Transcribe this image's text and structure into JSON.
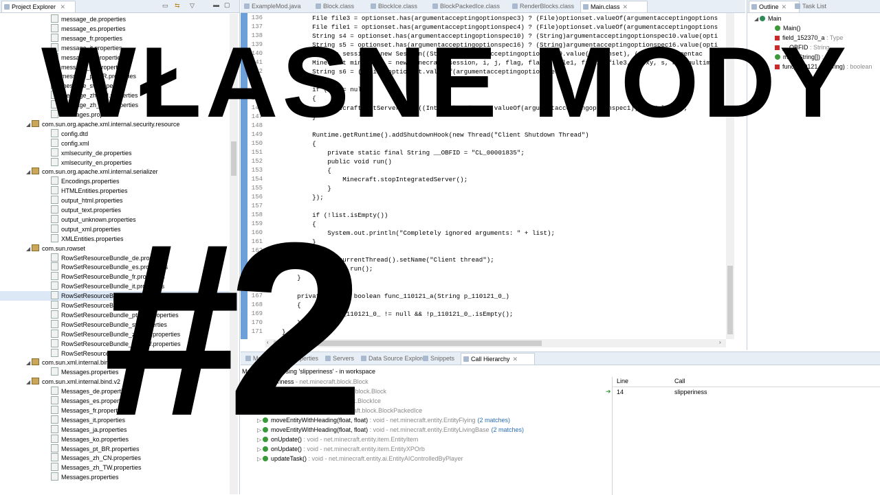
{
  "project_explorer": {
    "title": "Project Explorer",
    "items": [
      {
        "label": "message_de.properties",
        "indent": 2,
        "icon": "file"
      },
      {
        "label": "message_es.properties",
        "indent": 2,
        "icon": "file"
      },
      {
        "label": "message_fr.properties",
        "indent": 2,
        "icon": "file"
      },
      {
        "label": "message_it.properties",
        "indent": 2,
        "icon": "file"
      },
      {
        "label": "message_ja.properties",
        "indent": 2,
        "icon": "file"
      },
      {
        "label": "message_ko.properties",
        "indent": 2,
        "icon": "file"
      },
      {
        "label": "message_pt_BR.properties",
        "indent": 2,
        "icon": "file"
      },
      {
        "label": "message_sv.properties",
        "indent": 2,
        "icon": "file"
      },
      {
        "label": "message_zh_CN.properties",
        "indent": 2,
        "icon": "file"
      },
      {
        "label": "message_zh_TW.properties",
        "indent": 2,
        "icon": "file"
      },
      {
        "label": "messages.properties",
        "indent": 2,
        "icon": "file"
      },
      {
        "label": "com.sun.org.apache.xml.internal.security.resource",
        "indent": 1,
        "icon": "package",
        "twisty": "◢"
      },
      {
        "label": "config.dtd",
        "indent": 2,
        "icon": "file"
      },
      {
        "label": "config.xml",
        "indent": 2,
        "icon": "file"
      },
      {
        "label": "xmlsecurity_de.properties",
        "indent": 2,
        "icon": "file"
      },
      {
        "label": "xmlsecurity_en.properties",
        "indent": 2,
        "icon": "file"
      },
      {
        "label": "com.sun.org.apache.xml.internal.serializer",
        "indent": 1,
        "icon": "package",
        "twisty": "◢"
      },
      {
        "label": "Encodings.properties",
        "indent": 2,
        "icon": "file"
      },
      {
        "label": "HTMLEntities.properties",
        "indent": 2,
        "icon": "file"
      },
      {
        "label": "output_html.properties",
        "indent": 2,
        "icon": "file"
      },
      {
        "label": "output_text.properties",
        "indent": 2,
        "icon": "file"
      },
      {
        "label": "output_unknown.properties",
        "indent": 2,
        "icon": "file"
      },
      {
        "label": "output_xml.properties",
        "indent": 2,
        "icon": "file"
      },
      {
        "label": "XMLEntities.properties",
        "indent": 2,
        "icon": "file"
      },
      {
        "label": "com.sun.rowset",
        "indent": 1,
        "icon": "package",
        "twisty": "◢"
      },
      {
        "label": "RowSetResourceBundle_de.properties",
        "indent": 2,
        "icon": "file"
      },
      {
        "label": "RowSetResourceBundle_es.properties",
        "indent": 2,
        "icon": "file"
      },
      {
        "label": "RowSetResourceBundle_fr.properties",
        "indent": 2,
        "icon": "file"
      },
      {
        "label": "RowSetResourceBundle_it.properties",
        "indent": 2,
        "icon": "file"
      },
      {
        "label": "RowSetResourceBundle_ja.properties",
        "indent": 2,
        "icon": "file",
        "selected": true
      },
      {
        "label": "RowSetResourceBundle_ko.properties",
        "indent": 2,
        "icon": "file"
      },
      {
        "label": "RowSetResourceBundle_pt_BR.properties",
        "indent": 2,
        "icon": "file"
      },
      {
        "label": "RowSetResourceBundle_sv.properties",
        "indent": 2,
        "icon": "file"
      },
      {
        "label": "RowSetResourceBundle_zh_CN.properties",
        "indent": 2,
        "icon": "file"
      },
      {
        "label": "RowSetResourceBundle_zh_TW.properties",
        "indent": 2,
        "icon": "file"
      },
      {
        "label": "RowSetResourceBundle.properties",
        "indent": 2,
        "icon": "file"
      },
      {
        "label": "com.sun.xml.internal.bind",
        "indent": 1,
        "icon": "package",
        "twisty": "◢"
      },
      {
        "label": "Messages.properties",
        "indent": 2,
        "icon": "file"
      },
      {
        "label": "com.sun.xml.internal.bind.v2",
        "indent": 1,
        "icon": "package",
        "twisty": "◢"
      },
      {
        "label": "Messages_de.properties",
        "indent": 2,
        "icon": "file"
      },
      {
        "label": "Messages_es.properties",
        "indent": 2,
        "icon": "file"
      },
      {
        "label": "Messages_fr.properties",
        "indent": 2,
        "icon": "file"
      },
      {
        "label": "Messages_it.properties",
        "indent": 2,
        "icon": "file"
      },
      {
        "label": "Messages_ja.properties",
        "indent": 2,
        "icon": "file"
      },
      {
        "label": "Messages_ko.properties",
        "indent": 2,
        "icon": "file"
      },
      {
        "label": "Messages_pt_BR.properties",
        "indent": 2,
        "icon": "file"
      },
      {
        "label": "Messages_zh_CN.properties",
        "indent": 2,
        "icon": "file"
      },
      {
        "label": "Messages_zh_TW.properties",
        "indent": 2,
        "icon": "file"
      },
      {
        "label": "Messages.properties",
        "indent": 2,
        "icon": "file"
      }
    ]
  },
  "editor": {
    "tabs": [
      "ExampleMod.java",
      "Block.class",
      "BlockIce.class",
      "BlockPackedIce.class",
      "RenderBlocks.class",
      "Main.class"
    ],
    "active_tab": "Main.class",
    "lines": [
      {
        "n": "136",
        "html": "            File file3 = optionset.has(argumentacceptingoptionspec3) ? (File)optionset.valueOf(argumentacceptingoptions"
      },
      {
        "n": "137",
        "html": "            File file1 = optionset.has(argumentacceptingoptionspec4) ? (File)optionset.valueOf(argumentacceptingoptions"
      },
      {
        "n": "138",
        "html": "            String s4 = optionset.has(argumentacceptingoptionspec10) ? (String)argumentacceptingoptionspec10.value(opti"
      },
      {
        "n": "139",
        "html": "            String s5 = optionset.has(argumentacceptingoptionspec16) ? (String)argumentacceptingoptionspec16.value(opti"
      },
      {
        "n": "140",
        "html": "            Session session = new Session((String)argumentacceptingoptionspec9.value(optionset), (String)argumentac"
      },
      {
        "n": "141",
        "html": "            Minecraft minecraft = new Minecraft(session, i, j, flag, flag1, file1, file2, file3, proxy, s, hashmultima"
      },
      {
        "n": "142",
        "html": "            String s6 = (String)optionset.valueOf(argumentacceptingoptionspec);"
      },
      {
        "n": "143",
        "html": ""
      },
      {
        "n": "144",
        "html": "            if (s6 != null)"
      },
      {
        "n": "145",
        "html": "            {"
      },
      {
        "n": "146",
        "html": "                minecraft.setServer(s6, ((Integer)optionset.valueOf(argumentacceptingoptionspec1)).intValue());"
      },
      {
        "n": "147",
        "html": "            }"
      },
      {
        "n": "148",
        "html": ""
      },
      {
        "n": "149",
        "html": "            Runtime.getRuntime().addShutdownHook(new Thread(\"Client Shutdown Thread\")"
      },
      {
        "n": "150",
        "html": "            {"
      },
      {
        "n": "151",
        "html": "                private static final String __OBFID = \"CL_00001835\";"
      },
      {
        "n": "152",
        "html": "                public void run()"
      },
      {
        "n": "153",
        "html": "                {"
      },
      {
        "n": "154",
        "html": "                    Minecraft.stopIntegratedServer();"
      },
      {
        "n": "155",
        "html": "                }"
      },
      {
        "n": "156",
        "html": "            });"
      },
      {
        "n": "157",
        "html": ""
      },
      {
        "n": "158",
        "html": "            if (!list.isEmpty())"
      },
      {
        "n": "159",
        "html": "            {"
      },
      {
        "n": "160",
        "html": "                System.out.println(\"Completely ignored arguments: \" + list);"
      },
      {
        "n": "161",
        "html": "            }"
      },
      {
        "n": "162",
        "html": ""
      },
      {
        "n": "163",
        "html": "            Thread.currentThread().setName(\"Client thread\");"
      },
      {
        "n": "164",
        "html": "            minecraft.run();"
      },
      {
        "n": "165",
        "html": "        }"
      },
      {
        "n": "166",
        "html": ""
      },
      {
        "n": "167",
        "html": "        private static boolean func_110121_a(String p_110121_0_)"
      },
      {
        "n": "168",
        "html": "        {"
      },
      {
        "n": "169",
        "html": "            return p_110121_0_ != null && !p_110121_0_.isEmpty();"
      },
      {
        "n": "170",
        "html": "        }"
      },
      {
        "n": "171",
        "html": "    }"
      }
    ]
  },
  "outline": {
    "tabs": [
      "Outline",
      "Task List"
    ],
    "items": [
      {
        "label": "Main",
        "suffix": "",
        "indent": 0,
        "icon": "class"
      },
      {
        "label": "Main()",
        "suffix": "",
        "indent": 1,
        "icon": "green"
      },
      {
        "label": "field_152370_a",
        "suffix": " : Type",
        "indent": 1,
        "icon": "red"
      },
      {
        "label": "__OBFID",
        "suffix": " : String",
        "indent": 1,
        "icon": "red"
      },
      {
        "label": "main(String[])",
        "suffix": " : void",
        "indent": 1,
        "icon": "green"
      },
      {
        "label": "func_110121_a(String)",
        "suffix": " : boolean",
        "indent": 1,
        "icon": "red"
      }
    ]
  },
  "bottom_panel": {
    "tabs": [
      "Markers",
      "Properties",
      "Servers",
      "Data Source Explorer",
      "Snippets",
      "Call Hierarchy"
    ],
    "active_tab": "Call Hierarchy",
    "header": "Members accessing 'slipperiness' - in workspace",
    "root": {
      "label": "slipperiness",
      "detail": " - net.minecraft.block.Block"
    },
    "items": [
      {
        "label": "Block(Material)",
        "detail": " - net.minecraft.block.Block",
        "matches": ""
      },
      {
        "label": "BlockIce()",
        "detail": " - net.minecraft.block.BlockIce",
        "matches": ""
      },
      {
        "label": "BlockPackedIce()",
        "detail": " - net.minecraft.block.BlockPackedIce",
        "matches": ""
      },
      {
        "label": "moveEntityWithHeading(float, float)",
        "detail": " : void - net.minecraft.entity.EntityFlying",
        "matches": "(2 matches)"
      },
      {
        "label": "moveEntityWithHeading(float, float)",
        "detail": " : void - net.minecraft.entity.EntityLivingBase",
        "matches": "(2 matches)"
      },
      {
        "label": "onUpdate()",
        "detail": " : void - net.minecraft.entity.item.EntityItem",
        "matches": ""
      },
      {
        "label": "onUpdate()",
        "detail": " : void - net.minecraft.entity.item.EntityXPOrb",
        "matches": ""
      },
      {
        "label": "updateTask()",
        "detail": " : void - net.minecraft.entity.ai.EntityAIControlledByPlayer",
        "matches": ""
      }
    ],
    "columns": [
      "Line",
      "Call"
    ],
    "detail_row": {
      "line": "14",
      "call": "slipperiness"
    }
  },
  "overlay": {
    "title": "WŁASNE MODY",
    "number": "#2"
  }
}
